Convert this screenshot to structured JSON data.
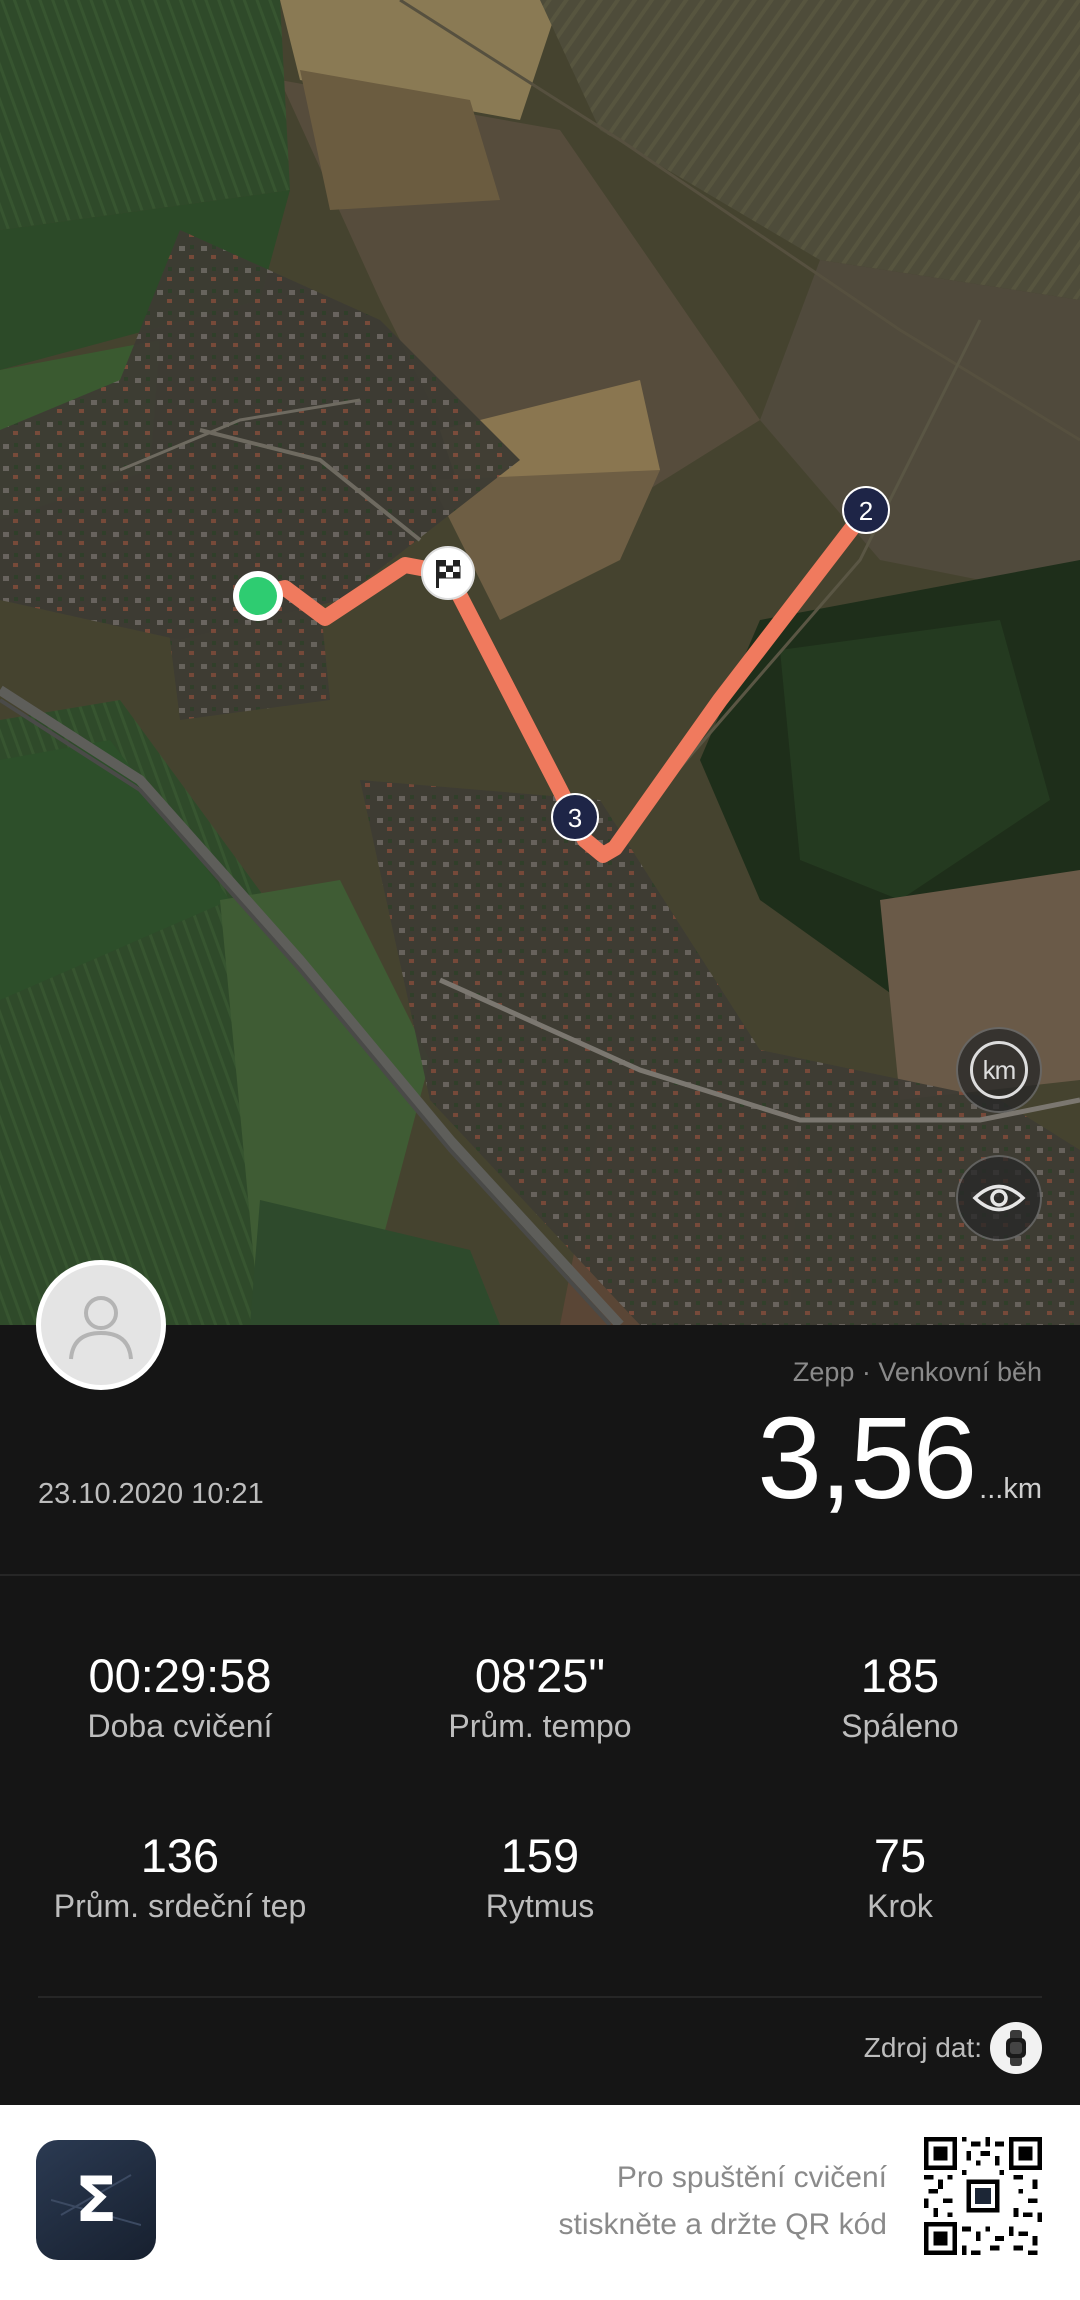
{
  "map": {
    "waypoints": [
      "2",
      "3"
    ],
    "km_button_label": "km",
    "icons": [
      "start-point-icon",
      "finish-flag-icon",
      "eye-icon",
      "person-icon"
    ]
  },
  "summary": {
    "source_and_type": "Zepp · Venkovní běh",
    "distance_value": "3,56",
    "distance_unit": "...km",
    "date_time": "23.10.2020 10:21"
  },
  "metrics": [
    {
      "value": "00:29:58",
      "label": "Doba cvičení"
    },
    {
      "value": "08'25\"",
      "label": "Prům. tempo"
    },
    {
      "value": "185",
      "label": "Spáleno"
    },
    {
      "value": "136",
      "label": "Prům. srdeční tep"
    },
    {
      "value": "159",
      "label": "Rytmus"
    },
    {
      "value": "75",
      "label": "Krok"
    }
  ],
  "data_source_label": "Zdroj dat:",
  "footer": {
    "qr_hint_line1": "Pro spuštění cvičení",
    "qr_hint_line2": "stiskněte a držte QR kód",
    "logo_glyph": "Σ"
  },
  "colors": {
    "route": "#f07a5e",
    "start": "#2ecc71",
    "waypoint": "#1e2547",
    "panel_bg": "#151515"
  }
}
